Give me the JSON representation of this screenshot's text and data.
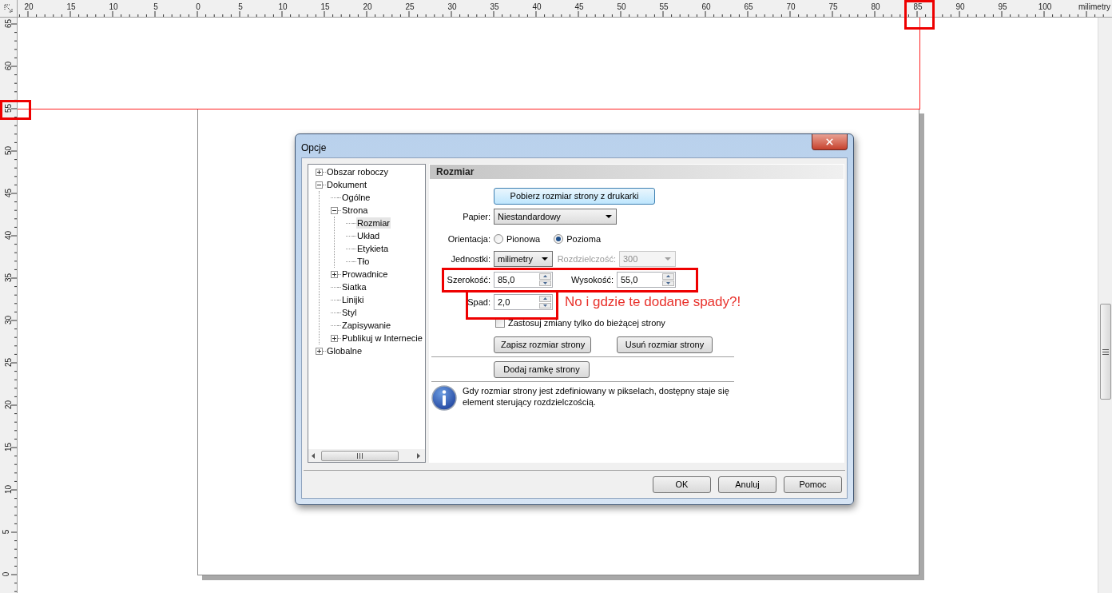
{
  "rulers": {
    "horizontal": {
      "labels": [
        "20",
        "15",
        "10",
        "5",
        "0",
        "5",
        "10",
        "15",
        "20",
        "25",
        "30",
        "35",
        "40",
        "45",
        "50",
        "55",
        "60",
        "65",
        "70",
        "75",
        "80",
        "85",
        "90",
        "95",
        "100"
      ],
      "unit": "milimetry"
    },
    "vertical": {
      "labels": [
        "65",
        "60",
        "55",
        "50",
        "45",
        "40",
        "35",
        "30",
        "25",
        "20",
        "15",
        "10",
        "5",
        "0"
      ]
    }
  },
  "dialog": {
    "title": "Opcje",
    "tree": [
      {
        "label": "Obszar roboczy",
        "expanded": false,
        "selected": false
      },
      {
        "label": "Dokument",
        "expanded": true,
        "selected": false,
        "children": [
          {
            "label": "Ogólne",
            "selected": false
          },
          {
            "label": "Strona",
            "expanded": true,
            "selected": false,
            "children": [
              {
                "label": "Rozmiar",
                "selected": true
              },
              {
                "label": "Układ",
                "selected": false
              },
              {
                "label": "Etykieta",
                "selected": false
              },
              {
                "label": "Tło",
                "selected": false
              }
            ]
          },
          {
            "label": "Prowadnice",
            "expanded": false,
            "selected": false
          },
          {
            "label": "Siatka",
            "selected": false
          },
          {
            "label": "Linijki",
            "selected": false
          },
          {
            "label": "Styl",
            "selected": false
          },
          {
            "label": "Zapisywanie",
            "selected": false
          },
          {
            "label": "Publikuj w Internecie",
            "expanded": false,
            "selected": false
          }
        ]
      },
      {
        "label": "Globalne",
        "expanded": false,
        "selected": false
      }
    ],
    "panel": {
      "header": "Rozmiar",
      "printer_button": "Pobierz rozmiar strony z drukarki",
      "paper": {
        "label": "Papier:",
        "value": "Niestandardowy"
      },
      "orientation": {
        "label": "Orientacja:",
        "options": [
          {
            "label": "Pionowa",
            "selected": false
          },
          {
            "label": "Pozioma",
            "selected": true
          }
        ]
      },
      "units": {
        "label": "Jednostki:",
        "value": "milimetry"
      },
      "resolution": {
        "label": "Rozdzielczość:",
        "value": "300",
        "disabled": true
      },
      "width": {
        "label": "Szerokość:",
        "value": "85,0"
      },
      "height": {
        "label": "Wysokość:",
        "value": "55,0"
      },
      "bleed": {
        "label": "Spad:",
        "value": "2,0"
      },
      "apply_current": {
        "label": "Zastosuj zmiany tylko do bieżącej strony",
        "checked": false
      },
      "save_button": "Zapisz rozmiar strony",
      "delete_button": "Usuń rozmiar strony",
      "frame_button": "Dodaj ramkę strony",
      "info": "Gdy rozmiar strony jest zdefiniowany w pikselach, dostępny staje się element sterujący rozdzielczością."
    },
    "buttons": [
      "OK",
      "Anuluj",
      "Pomoc"
    ]
  },
  "annotation": {
    "text": "No i gdzie te dodane spady?!"
  }
}
